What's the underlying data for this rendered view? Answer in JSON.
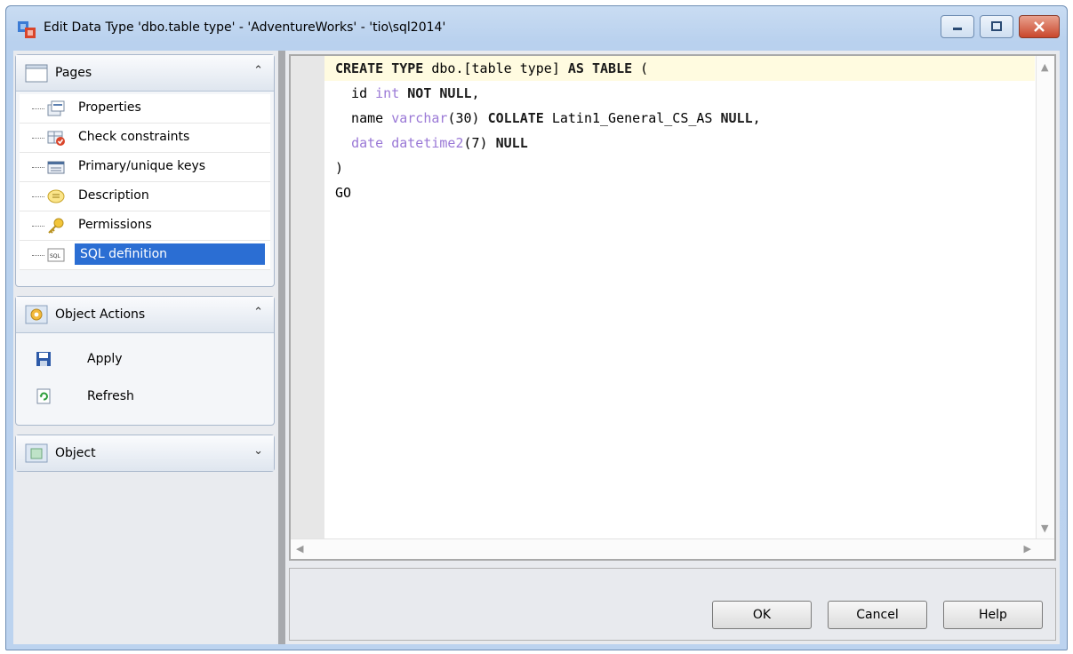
{
  "window": {
    "title": "Edit Data Type 'dbo.table type' - 'AdventureWorks' - 'tio\\sql2014'"
  },
  "pages_panel": {
    "header": "Pages",
    "items": [
      {
        "label": "Properties",
        "icon": "properties-icon"
      },
      {
        "label": "Check constraints",
        "icon": "check-constraints-icon"
      },
      {
        "label": "Primary/unique keys",
        "icon": "keys-icon"
      },
      {
        "label": "Description",
        "icon": "description-icon"
      },
      {
        "label": "Permissions",
        "icon": "key-icon"
      },
      {
        "label": "SQL definition",
        "icon": "sql-icon",
        "selected": true
      }
    ]
  },
  "actions_panel": {
    "header": "Object Actions",
    "items": [
      {
        "label": "Apply",
        "icon": "save-icon"
      },
      {
        "label": "Refresh",
        "icon": "refresh-icon"
      }
    ]
  },
  "object_panel": {
    "header": "Object"
  },
  "editor": {
    "lines": [
      "CREATE TYPE dbo.[table type] AS TABLE (",
      "  id int NOT NULL,",
      "  name varchar(30) COLLATE Latin1_General_CS_AS NULL,",
      "  date datetime2(7) NULL",
      ")",
      "GO"
    ]
  },
  "buttons": {
    "ok": "OK",
    "cancel": "Cancel",
    "help": "Help"
  },
  "colors": {
    "selection": "#2b6ed3",
    "type_keyword": "#9a78d6",
    "active_line": "#fffbe0"
  }
}
